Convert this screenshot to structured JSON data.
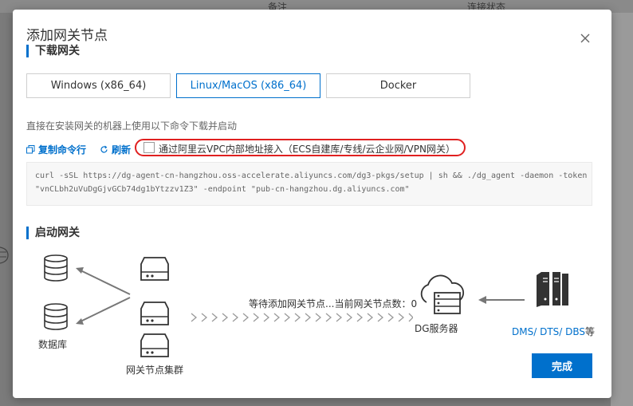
{
  "background": {
    "col_notes": "备注",
    "col_status": "连接状态"
  },
  "modal": {
    "title": "添加网关节点",
    "section_download": "下载网关",
    "os_tabs": [
      "Windows (x86_64)",
      "Linux/MacOS (x86_64)",
      "Docker"
    ],
    "active_tab": "Linux/MacOS (x86_64)",
    "hint": "直接在安装网关的机器上使用以下命令下载并启动",
    "copy_label": "复制命令行",
    "refresh_label": "刷新",
    "vpc_label": "通过阿里云VPC内部地址接入（ECS自建库/专线/云企业网/VPN网关）",
    "vpc_checked": false,
    "command_line1": "curl -sSL https://dg-agent-cn-hangzhou.oss-accelerate.aliyuncs.com/dg3-pkgs/setup | sh && ./dg_agent -daemon -token",
    "command_line2": "\"vnCLbh2uVuDgGjvGCb74dg1bYtzzv1Z3\" -endpoint \"pub-cn-hangzhou.dg.aliyuncs.com\"",
    "section_start": "启动网关",
    "diagram": {
      "db_label": "数据库",
      "cluster_label": "网关节点集群",
      "waiting_text": "等待添加网关节点...当前网关节点数：0",
      "dg_server_label": "DG服务器",
      "dms": "DMS",
      "dts": "DTS",
      "dbs": "DBS",
      "suffix": "等"
    },
    "done_label": "完成"
  },
  "colors": {
    "accent": "#0070cc",
    "highlight": "#e02020"
  }
}
